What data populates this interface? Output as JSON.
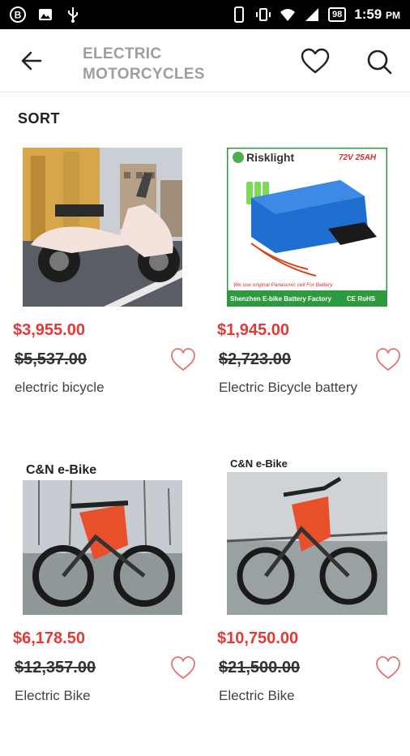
{
  "status": {
    "battery": "98",
    "time": "1:59",
    "ampm": "PM"
  },
  "header": {
    "title_line1": "ELECTRIC",
    "title_line2": "MOTORCYCLES"
  },
  "sort_label": "SORT",
  "colors": {
    "price": "#e53935",
    "heart": "#e57373",
    "title": "#9e9e9e"
  },
  "products": [
    {
      "price": "$3,955.00",
      "old_price": "$5,537.00",
      "name": "electric bicycle"
    },
    {
      "price": "$1,945.00",
      "old_price": "$2,723.00",
      "name": "Electric Bicycle battery",
      "image_text": {
        "brand": "Risklight",
        "spec": "72V 25AH",
        "note": "We use original Panasonic cell For Battery",
        "factory": "Shenzhen E-bike Battery Factory",
        "cert": "CE RoHS"
      }
    },
    {
      "price": "$6,178.50",
      "old_price": "$12,357.00",
      "name": "Electric Bike",
      "image_text": {
        "brand": "C&N e-Bike"
      }
    },
    {
      "price": "$10,750.00",
      "old_price": "$21,500.00",
      "name": "Electric Bike",
      "image_text": {
        "brand": "C&N e-Bike"
      }
    }
  ]
}
